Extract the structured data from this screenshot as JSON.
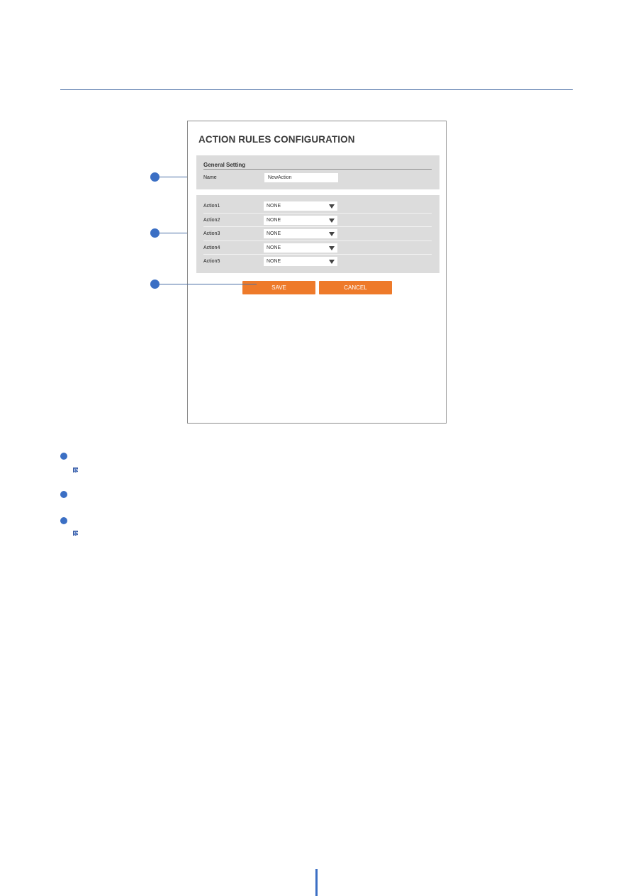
{
  "screen": {
    "title": "ACTION RULES CONFIGURATION",
    "general_setting": {
      "section_title": "General Setting",
      "name_label": "Name",
      "name_value": "NewAction"
    },
    "actions": [
      {
        "label": "Action1",
        "value": "NONE"
      },
      {
        "label": "Action2",
        "value": "NONE"
      },
      {
        "label": "Action3",
        "value": "NONE"
      },
      {
        "label": "Action4",
        "value": "NONE"
      },
      {
        "label": "Action5",
        "value": "NONE"
      }
    ],
    "buttons": {
      "save": "SAVE",
      "cancel": "CANCEL"
    }
  },
  "colors": {
    "accent_blue": "#3b6fc4",
    "button_orange": "#ee7a2a",
    "panel_gray": "#dcdcdc"
  },
  "callouts": [
    "name-field",
    "action-selects",
    "save-button"
  ],
  "notes": [
    {
      "has_note_icon": true
    },
    {
      "has_note_icon": false
    },
    {
      "has_note_icon": true
    }
  ]
}
